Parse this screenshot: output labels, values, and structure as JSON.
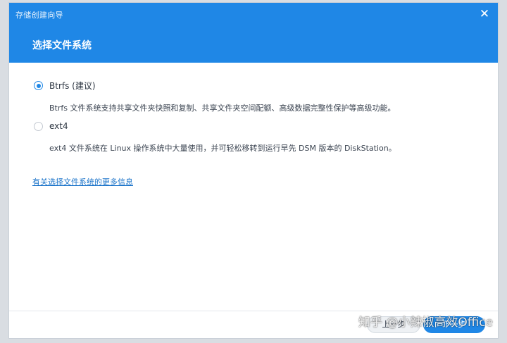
{
  "window": {
    "title": "存储创建向导",
    "close_glyph": "✕"
  },
  "header": {
    "step_title": "选择文件系统"
  },
  "options": [
    {
      "label": "Btrfs (建议)",
      "description": "Btrfs 文件系统支持共享文件夹快照和复制、共享文件夹空间配额、高级数据完整性保护等高级功能。",
      "selected": true
    },
    {
      "label": "ext4",
      "description": "ext4 文件系统在 Linux 操作系统中大量使用，并可轻松移转到运行早先 DSM 版本的 DiskStation。",
      "selected": false
    }
  ],
  "more_info_link": "有关选择文件系统的更多信息",
  "footer": {
    "back_label": "上一步",
    "next_label": "下一步"
  },
  "watermark": "知乎 @小辣椒高效Office",
  "colors": {
    "accent": "#1f87e6",
    "link": "#1a73c9"
  }
}
